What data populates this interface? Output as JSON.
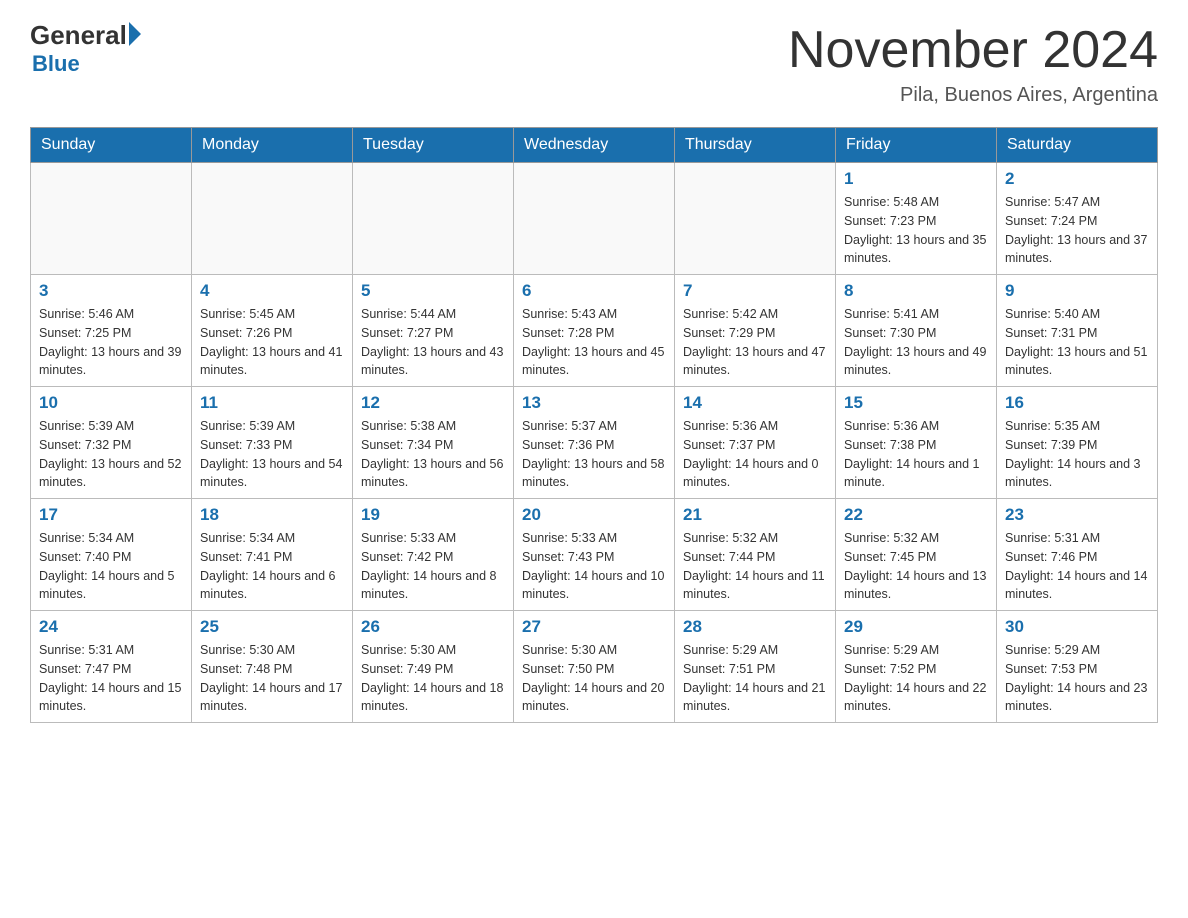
{
  "logo": {
    "general": "General",
    "blue": "Blue"
  },
  "header": {
    "month_year": "November 2024",
    "location": "Pila, Buenos Aires, Argentina"
  },
  "days_of_week": [
    "Sunday",
    "Monday",
    "Tuesday",
    "Wednesday",
    "Thursday",
    "Friday",
    "Saturday"
  ],
  "weeks": [
    [
      {
        "day": "",
        "info": ""
      },
      {
        "day": "",
        "info": ""
      },
      {
        "day": "",
        "info": ""
      },
      {
        "day": "",
        "info": ""
      },
      {
        "day": "",
        "info": ""
      },
      {
        "day": "1",
        "info": "Sunrise: 5:48 AM\nSunset: 7:23 PM\nDaylight: 13 hours and 35 minutes."
      },
      {
        "day": "2",
        "info": "Sunrise: 5:47 AM\nSunset: 7:24 PM\nDaylight: 13 hours and 37 minutes."
      }
    ],
    [
      {
        "day": "3",
        "info": "Sunrise: 5:46 AM\nSunset: 7:25 PM\nDaylight: 13 hours and 39 minutes."
      },
      {
        "day": "4",
        "info": "Sunrise: 5:45 AM\nSunset: 7:26 PM\nDaylight: 13 hours and 41 minutes."
      },
      {
        "day": "5",
        "info": "Sunrise: 5:44 AM\nSunset: 7:27 PM\nDaylight: 13 hours and 43 minutes."
      },
      {
        "day": "6",
        "info": "Sunrise: 5:43 AM\nSunset: 7:28 PM\nDaylight: 13 hours and 45 minutes."
      },
      {
        "day": "7",
        "info": "Sunrise: 5:42 AM\nSunset: 7:29 PM\nDaylight: 13 hours and 47 minutes."
      },
      {
        "day": "8",
        "info": "Sunrise: 5:41 AM\nSunset: 7:30 PM\nDaylight: 13 hours and 49 minutes."
      },
      {
        "day": "9",
        "info": "Sunrise: 5:40 AM\nSunset: 7:31 PM\nDaylight: 13 hours and 51 minutes."
      }
    ],
    [
      {
        "day": "10",
        "info": "Sunrise: 5:39 AM\nSunset: 7:32 PM\nDaylight: 13 hours and 52 minutes."
      },
      {
        "day": "11",
        "info": "Sunrise: 5:39 AM\nSunset: 7:33 PM\nDaylight: 13 hours and 54 minutes."
      },
      {
        "day": "12",
        "info": "Sunrise: 5:38 AM\nSunset: 7:34 PM\nDaylight: 13 hours and 56 minutes."
      },
      {
        "day": "13",
        "info": "Sunrise: 5:37 AM\nSunset: 7:36 PM\nDaylight: 13 hours and 58 minutes."
      },
      {
        "day": "14",
        "info": "Sunrise: 5:36 AM\nSunset: 7:37 PM\nDaylight: 14 hours and 0 minutes."
      },
      {
        "day": "15",
        "info": "Sunrise: 5:36 AM\nSunset: 7:38 PM\nDaylight: 14 hours and 1 minute."
      },
      {
        "day": "16",
        "info": "Sunrise: 5:35 AM\nSunset: 7:39 PM\nDaylight: 14 hours and 3 minutes."
      }
    ],
    [
      {
        "day": "17",
        "info": "Sunrise: 5:34 AM\nSunset: 7:40 PM\nDaylight: 14 hours and 5 minutes."
      },
      {
        "day": "18",
        "info": "Sunrise: 5:34 AM\nSunset: 7:41 PM\nDaylight: 14 hours and 6 minutes."
      },
      {
        "day": "19",
        "info": "Sunrise: 5:33 AM\nSunset: 7:42 PM\nDaylight: 14 hours and 8 minutes."
      },
      {
        "day": "20",
        "info": "Sunrise: 5:33 AM\nSunset: 7:43 PM\nDaylight: 14 hours and 10 minutes."
      },
      {
        "day": "21",
        "info": "Sunrise: 5:32 AM\nSunset: 7:44 PM\nDaylight: 14 hours and 11 minutes."
      },
      {
        "day": "22",
        "info": "Sunrise: 5:32 AM\nSunset: 7:45 PM\nDaylight: 14 hours and 13 minutes."
      },
      {
        "day": "23",
        "info": "Sunrise: 5:31 AM\nSunset: 7:46 PM\nDaylight: 14 hours and 14 minutes."
      }
    ],
    [
      {
        "day": "24",
        "info": "Sunrise: 5:31 AM\nSunset: 7:47 PM\nDaylight: 14 hours and 15 minutes."
      },
      {
        "day": "25",
        "info": "Sunrise: 5:30 AM\nSunset: 7:48 PM\nDaylight: 14 hours and 17 minutes."
      },
      {
        "day": "26",
        "info": "Sunrise: 5:30 AM\nSunset: 7:49 PM\nDaylight: 14 hours and 18 minutes."
      },
      {
        "day": "27",
        "info": "Sunrise: 5:30 AM\nSunset: 7:50 PM\nDaylight: 14 hours and 20 minutes."
      },
      {
        "day": "28",
        "info": "Sunrise: 5:29 AM\nSunset: 7:51 PM\nDaylight: 14 hours and 21 minutes."
      },
      {
        "day": "29",
        "info": "Sunrise: 5:29 AM\nSunset: 7:52 PM\nDaylight: 14 hours and 22 minutes."
      },
      {
        "day": "30",
        "info": "Sunrise: 5:29 AM\nSunset: 7:53 PM\nDaylight: 14 hours and 23 minutes."
      }
    ]
  ]
}
